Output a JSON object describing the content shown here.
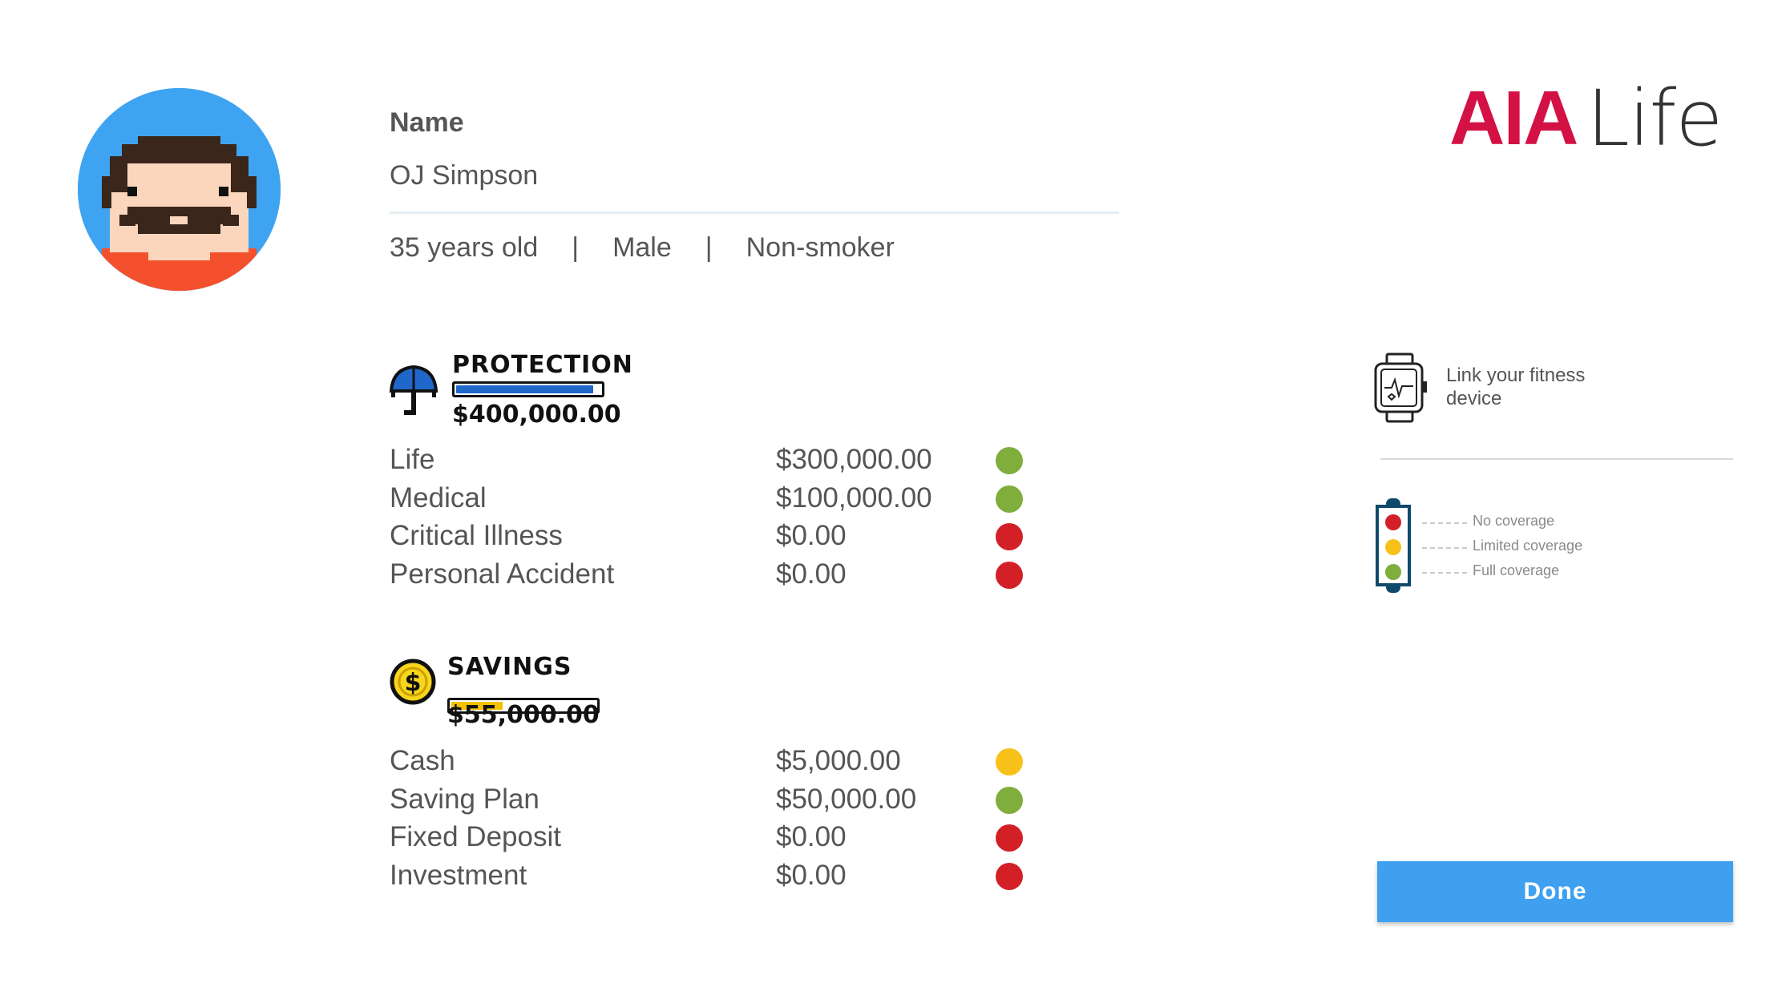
{
  "profile": {
    "name_label": "Name",
    "name": "OJ Simpson",
    "age": "35 years old",
    "separator": "|",
    "gender": "Male",
    "smoker_status": "Non-smoker"
  },
  "logo": {
    "brand": "AIA",
    "product": "Life",
    "brand_color": "#d31145"
  },
  "protection": {
    "title": "PROTECTION",
    "total": "$400,000.00",
    "icon": "umbrella-icon",
    "bar_fill_fraction": 0.98,
    "bar_color": "#1f67c9",
    "items": [
      {
        "label": "Life",
        "amount": "$300,000.00",
        "status": "full"
      },
      {
        "label": "Medical",
        "amount": "$100,000.00",
        "status": "full"
      },
      {
        "label": "Critical Illness",
        "amount": "$0.00",
        "status": "none"
      },
      {
        "label": "Personal Accident",
        "amount": "$0.00",
        "status": "none"
      }
    ]
  },
  "savings": {
    "title": "SAVINGS",
    "total": "$55,000.00",
    "icon": "dollar-coin-icon",
    "bar_fill_fraction": 0.37,
    "bar_color": "#f2c200",
    "items": [
      {
        "label": "Cash",
        "amount": "$5,000.00",
        "status": "limited"
      },
      {
        "label": "Saving Plan",
        "amount": "$50,000.00",
        "status": "full"
      },
      {
        "label": "Fixed Deposit",
        "amount": "$0.00",
        "status": "none"
      },
      {
        "label": "Investment",
        "amount": "$0.00",
        "status": "none"
      }
    ]
  },
  "status_colors": {
    "none": "#d32027",
    "limited": "#f7c11a",
    "full": "#7fae3d"
  },
  "fitness": {
    "label": "Link your fitness device",
    "icon": "smartwatch-icon"
  },
  "legend": {
    "icon": "traffic-light-icon",
    "items": [
      {
        "label": "No coverage",
        "status": "none"
      },
      {
        "label": "Limited coverage",
        "status": "limited"
      },
      {
        "label": "Full coverage",
        "status": "full"
      }
    ]
  },
  "done_button": {
    "label": "Done",
    "color": "#3fa0f0"
  }
}
